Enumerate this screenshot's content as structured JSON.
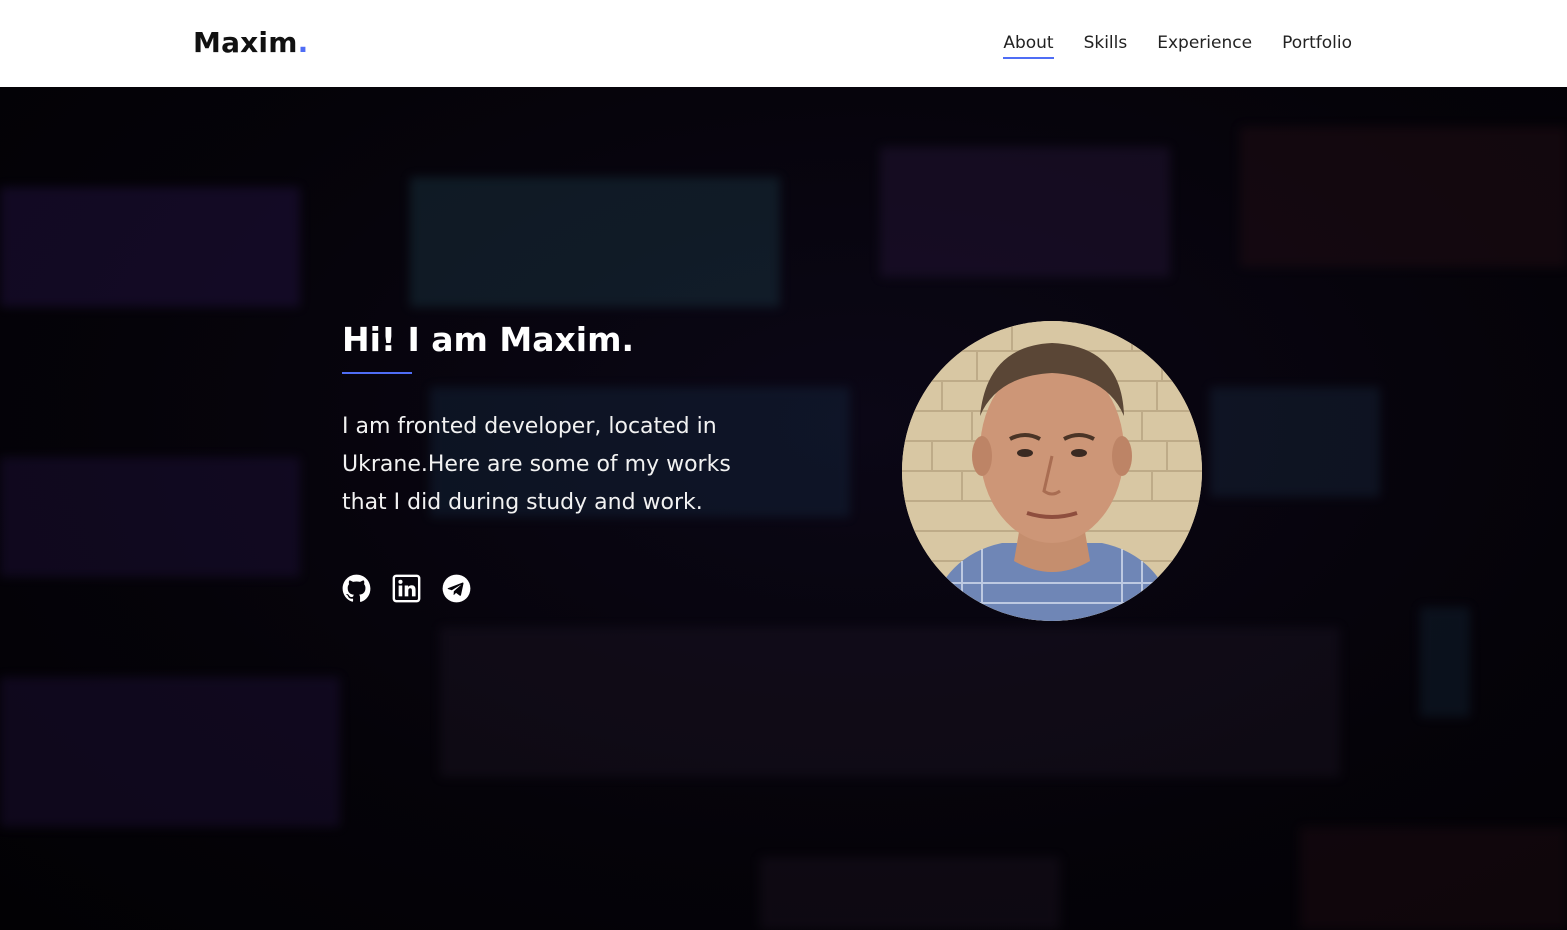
{
  "logo": {
    "name": "Maxim",
    "dot": "."
  },
  "nav": {
    "items": [
      {
        "label": "About",
        "active": true
      },
      {
        "label": "Skills",
        "active": false
      },
      {
        "label": "Experience",
        "active": false
      },
      {
        "label": "Portfolio",
        "active": false
      }
    ]
  },
  "hero": {
    "title": "Hi! I am Maxim.",
    "text": "I am fronted developer, located in Ukrane.Here are some of my works that I did during study and work.",
    "socials": [
      {
        "icon": "github-icon"
      },
      {
        "icon": "linkedin-icon"
      },
      {
        "icon": "telegram-icon"
      }
    ],
    "avatar_icon": "profile-photo"
  },
  "colors": {
    "accent": "#4f6df5",
    "header_bg": "#ffffff",
    "hero_bg": "#050309",
    "hero_text": "#ffffff"
  }
}
